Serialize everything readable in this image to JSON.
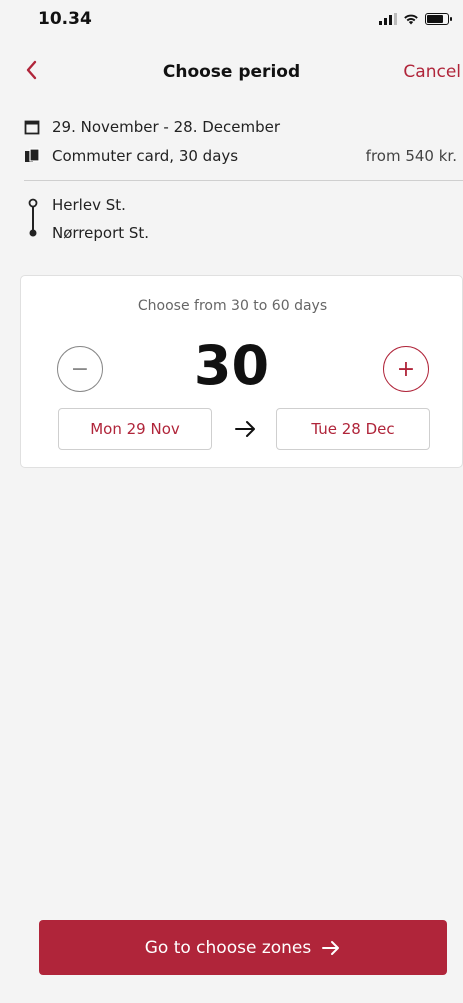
{
  "status_bar": {
    "time": "10.34",
    "battery_level": 0.85
  },
  "nav": {
    "title": "Choose period",
    "cancel_label": "Cancel",
    "back_icon": "chevron-left-icon"
  },
  "summary": {
    "period_text": "29. November - 28. December",
    "product_text": "Commuter card, 30 days",
    "price_text": "from 540 kr."
  },
  "route": {
    "from": "Herlev St.",
    "to": "Nørreport St."
  },
  "period_picker": {
    "hint": "Choose from 30 to 60 days",
    "days": "30",
    "minus_label": "−",
    "plus_label": "+",
    "start_date": "Mon 29 Nov",
    "end_date": "Tue 28 Dec"
  },
  "footer": {
    "primary_label": "Go to choose zones"
  },
  "colors": {
    "accent": "#b0253a",
    "background": "#f4f4f4",
    "card": "#ffffff"
  }
}
